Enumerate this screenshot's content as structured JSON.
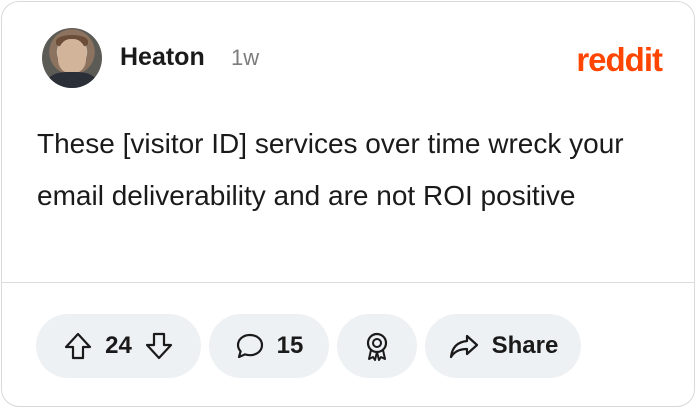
{
  "post": {
    "author": "Heaton",
    "age": "1w",
    "brand": "reddit",
    "body": "These [visitor ID] services over time wreck your email deliverability and are not ROI positive"
  },
  "actions": {
    "votes": "24",
    "comments": "15",
    "share_label": "Share"
  },
  "icons": [
    "upvote-icon",
    "downvote-icon",
    "comment-icon",
    "award-icon",
    "share-icon"
  ],
  "colors": {
    "brand": "#ff4500",
    "pill_bg": "#eef1f3",
    "text": "#1a1a1b",
    "muted": "#7c7c7c"
  }
}
